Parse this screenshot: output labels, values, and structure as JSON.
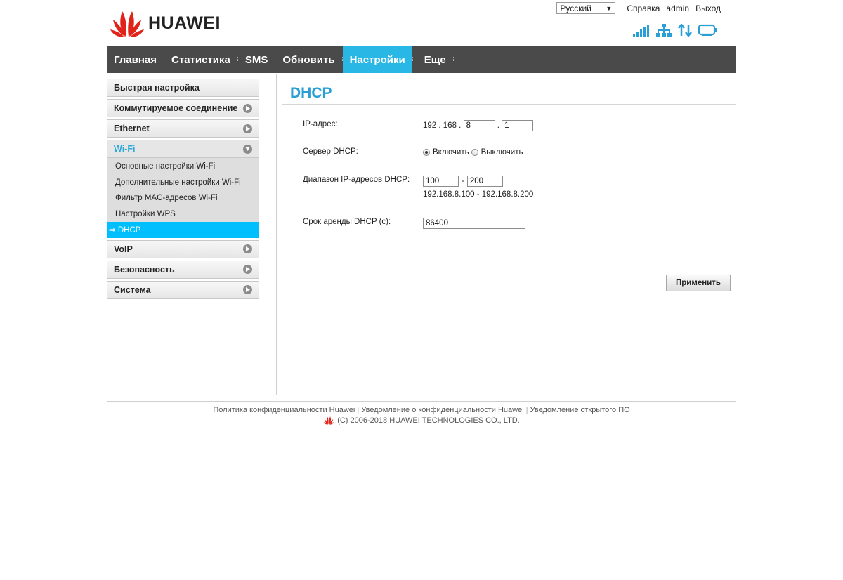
{
  "header": {
    "brand": "HUAWEI",
    "language": "Русский",
    "links": {
      "help": "Справка",
      "user": "admin",
      "logout": "Выход"
    },
    "status_icons": [
      "signal-strength-icon",
      "network-icon",
      "data-transfer-icon",
      "wifi-device-icon"
    ]
  },
  "nav": {
    "items": [
      {
        "label": "Главная"
      },
      {
        "label": "Статистика"
      },
      {
        "label": "SMS"
      },
      {
        "label": "Обновить"
      },
      {
        "label": "Настройки",
        "active": true
      },
      {
        "label": "Еще"
      }
    ]
  },
  "sidebar": {
    "items": [
      {
        "label": "Быстрая настройка"
      },
      {
        "label": "Коммутируемое соединение"
      },
      {
        "label": "Ethernet"
      },
      {
        "label": "Wi-Fi",
        "open": true
      },
      {
        "label": "VoIP"
      },
      {
        "label": "Безопасность"
      },
      {
        "label": "Система"
      }
    ],
    "wifi_sub": [
      {
        "label": "Основные настройки Wi-Fi"
      },
      {
        "label": "Дополнительные настройки Wi-Fi"
      },
      {
        "label": "Фильтр MAC-адресов Wi-Fi"
      },
      {
        "label": "Настройки WPS"
      },
      {
        "label": "⇒ DHCP",
        "active": true
      }
    ]
  },
  "main": {
    "title": "DHCP",
    "ip": {
      "label": "IP-адрес:",
      "octet1": "192",
      "octet2": "168",
      "octet3": "8",
      "octet4": "1"
    },
    "dhcp_server": {
      "label": "Сервер DHCP:",
      "on_label": "Включить",
      "off_label": "Выключить",
      "selected": "on"
    },
    "range": {
      "label": "Диапазон IP-адресов DHCP:",
      "start": "100",
      "end": "200",
      "separator": "-",
      "summary": "192.168.8.100 - 192.168.8.200"
    },
    "lease": {
      "label": "Срок аренды DHCP (с):",
      "value": "86400"
    },
    "apply_label": "Применить"
  },
  "footer": {
    "links": [
      "Политика конфиденциальности Huawei",
      "Уведомление о конфиденциальности Huawei",
      "Уведомление открытого ПО"
    ],
    "copyright": "(C) 2006-2018 HUAWEI TECHNOLOGIES CO., LTD."
  },
  "colors": {
    "accent": "#29b8e6",
    "nav_bg": "#4a4a4a",
    "title": "#2a9fd6",
    "brand_red": "#e2231a"
  }
}
